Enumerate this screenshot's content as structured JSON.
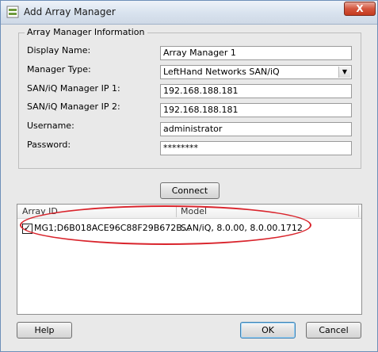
{
  "window": {
    "title": "Add Array Manager"
  },
  "group": {
    "legend": "Array Manager Information"
  },
  "form": {
    "display_name": {
      "label": "Display Name:",
      "value": "Array Manager 1"
    },
    "manager_type": {
      "label": "Manager Type:",
      "value": "LeftHand Networks SAN/iQ"
    },
    "ip1": {
      "label": "SAN/iQ Manager IP 1:",
      "value": "192.168.188.181"
    },
    "ip2": {
      "label": "SAN/iQ Manager IP 2:",
      "value": "192.168.188.181"
    },
    "username": {
      "label": "Username:",
      "value": "administrator"
    },
    "password": {
      "label": "Password:",
      "value": "********"
    }
  },
  "buttons": {
    "connect": "Connect",
    "help": "Help",
    "ok": "OK",
    "cancel": "Cancel",
    "close": "X"
  },
  "table": {
    "columns": [
      "Array ID",
      "Model"
    ],
    "rows": [
      {
        "checked": true,
        "array_id": "MG1;D6B018ACE96C88F29B672B...",
        "model": "SAN/iQ, 8.0.00, 8.0.00.1712"
      }
    ]
  },
  "colors": {
    "annotation": "#d9242c",
    "close": "#c43a1e"
  },
  "icons": {
    "app": "array-manager-icon",
    "dropdown": "chevron-down-icon",
    "check": "check-icon"
  }
}
